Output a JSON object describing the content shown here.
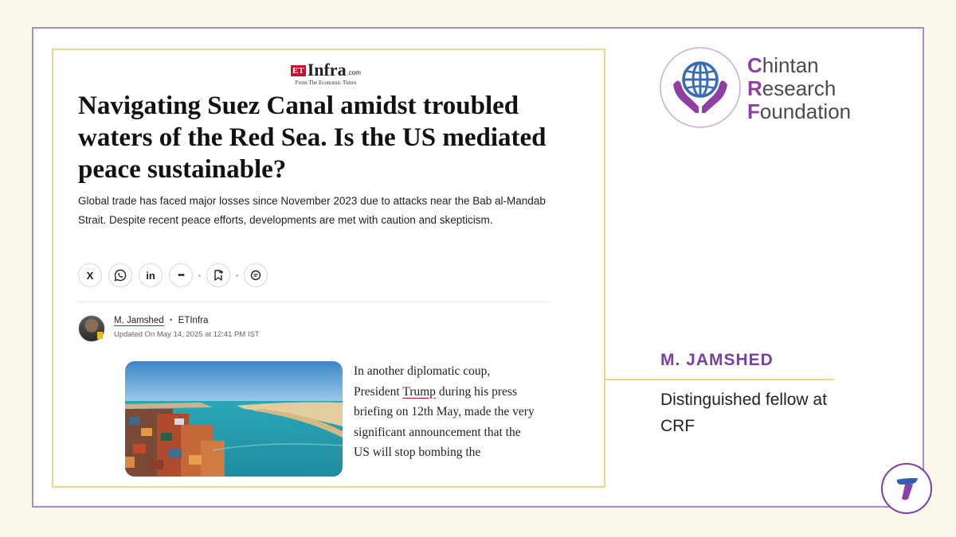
{
  "article": {
    "logo": {
      "et": "ET",
      "infra": "Infra",
      "dotcom": ".com",
      "tagline": "From The Economic Times"
    },
    "headline": "Navigating Suez Canal amidst troubled waters of the Red Sea. Is the US mediated peace sustainable?",
    "summary": "Global trade has faced major losses since November 2023 due to attacks near the Bab al-Mandab Strait. Despite recent peace efforts, developments are met with caution and skepticism.",
    "share_buttons": [
      {
        "icon": "x-icon",
        "label": "X"
      },
      {
        "icon": "whatsapp-icon"
      },
      {
        "icon": "linkedin-icon",
        "label": "in"
      },
      {
        "icon": "more-icon",
        "label": "•••"
      },
      {
        "icon": "bookmark-add-icon"
      },
      {
        "icon": "comment-icon"
      }
    ],
    "author": "M. Jamshed",
    "publication": "ETInfra",
    "updated": "Updated On May 14, 2025 at 12:41 PM IST",
    "body_before": "In another diplomatic coup, President ",
    "body_link": "Trump",
    "body_after": " during his press briefing on 12th May, made the very significant announcement that the US will stop bombing the"
  },
  "org": {
    "logo_icon": "globe-in-hands-icon",
    "name_lines": [
      {
        "cap": "C",
        "rest": "hintan"
      },
      {
        "cap": "R",
        "rest": "esearch"
      },
      {
        "cap": "F",
        "rest": "oundation"
      }
    ]
  },
  "author_card": {
    "name": "M. JAMSHED",
    "title": "Distinguished fellow at CRF"
  },
  "colors": {
    "accent_purple": "#7b3fa0",
    "accent_gold": "#e8d98e",
    "et_red": "#c8102e",
    "background": "#fbf8ec"
  }
}
